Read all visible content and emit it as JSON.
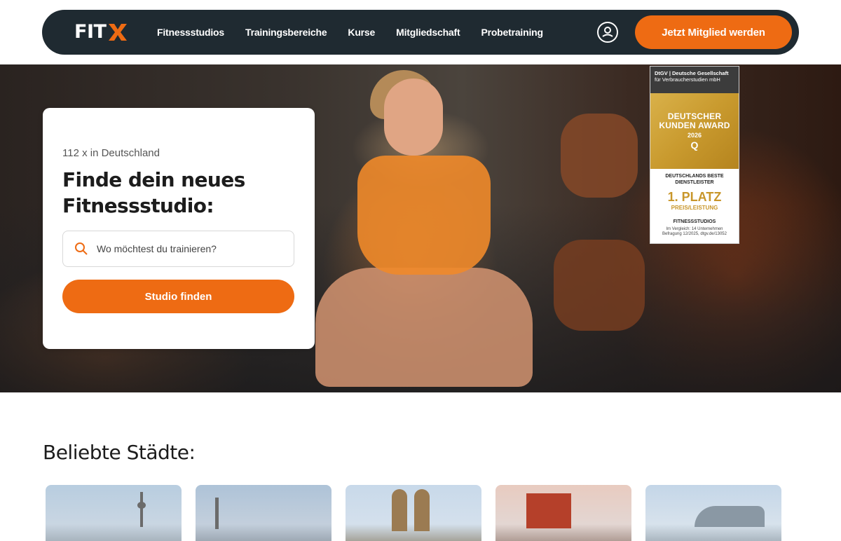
{
  "nav": {
    "logo_text": "FIT",
    "menu": [
      "Fitnessstudios",
      "Trainingsbereiche",
      "Kurse",
      "Mitgliedschaft",
      "Probetraining"
    ],
    "cta_label": "Jetzt Mitglied werden"
  },
  "colors": {
    "brand_orange": "#ee6b13",
    "nav_bg": "#1f2a31"
  },
  "hero": {
    "eyebrow": "112 x in Deutschland",
    "title": "Finde dein neues Fitnessstudio:",
    "search_placeholder": "Wo möchtest du trainieren?",
    "search_button": "Studio finden"
  },
  "award": {
    "org_line1": "DtGV | Deutsche Gesellschaft",
    "org_line2": "für Verbraucherstudien mbH",
    "title": "DEUTSCHER KUNDEN AWARD",
    "year": "2026",
    "q": "Q",
    "subtitle": "DEUTSCHLANDS BESTE DIENSTLEISTER",
    "place": "1. PLATZ",
    "place_sub": "PREIS/LEISTUNG",
    "category": "FITNESSSTUDIOS",
    "fine1": "Im Vergleich: 14 Unternehmen",
    "fine2": "Befragung 12/2025, dtgv.de/13052"
  },
  "cities": {
    "title": "Beliebte Städte:",
    "items": [
      "city-berlin",
      "city-duesseldorf",
      "city-muenchen",
      "city-essen",
      "city-hamburg"
    ]
  }
}
